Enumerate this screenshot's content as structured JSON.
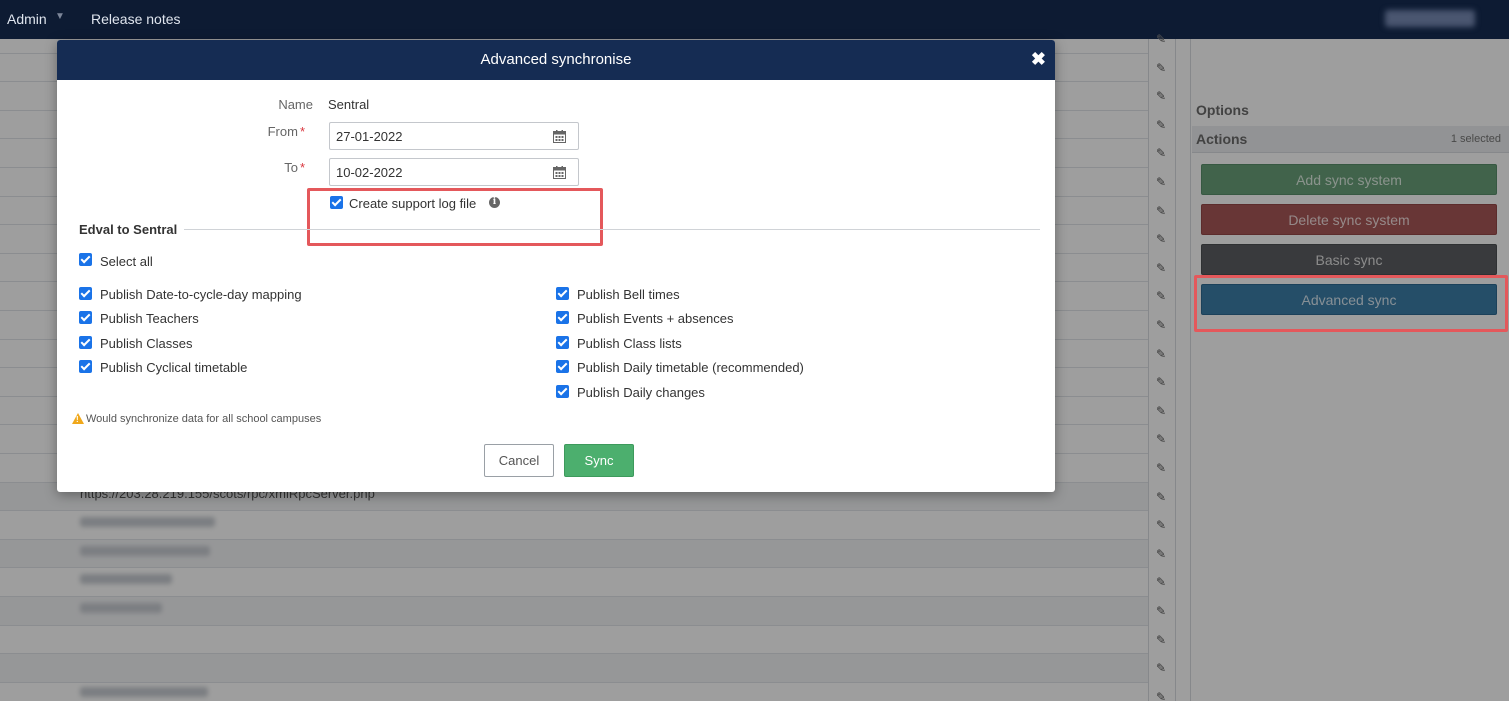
{
  "topnav": {
    "admin_label": "Admin",
    "release_notes_label": "Release notes"
  },
  "background": {
    "server_url": "https://203.28.219.155/scots/rpc/xmlRpcServer.php"
  },
  "sidebar": {
    "options_title": "Options",
    "actions_title": "Actions",
    "selected_count": "1 selected",
    "buttons": {
      "add": "Add sync system",
      "delete": "Delete sync system",
      "basic": "Basic sync",
      "advanced": "Advanced sync"
    }
  },
  "modal": {
    "title": "Advanced synchronise",
    "close_glyph": "✖",
    "name_label": "Name",
    "name_value": "Sentral",
    "from_label": "From",
    "from_value": "27-01-2022",
    "to_label": "To",
    "to_value": "10-02-2022",
    "support_log_label": "Create support log file",
    "section_title": "Edval to Sentral",
    "select_all_label": "Select all",
    "left_options": [
      "Publish Date-to-cycle-day mapping",
      "Publish Teachers",
      "Publish Classes",
      "Publish Cyclical timetable"
    ],
    "right_options": [
      "Publish Bell times",
      "Publish Events + absences",
      "Publish Class lists",
      "Publish Daily timetable (recommended)",
      "Publish Daily changes"
    ],
    "warning_text": "Would synchronize data for all school campuses",
    "cancel_label": "Cancel",
    "sync_label": "Sync"
  },
  "colors": {
    "nav_bg": "#0d1b33",
    "modal_header_bg": "#152c53",
    "checkbox": "#1a73e8",
    "sync_button": "#4caf6e",
    "highlight": "#e4585b"
  }
}
